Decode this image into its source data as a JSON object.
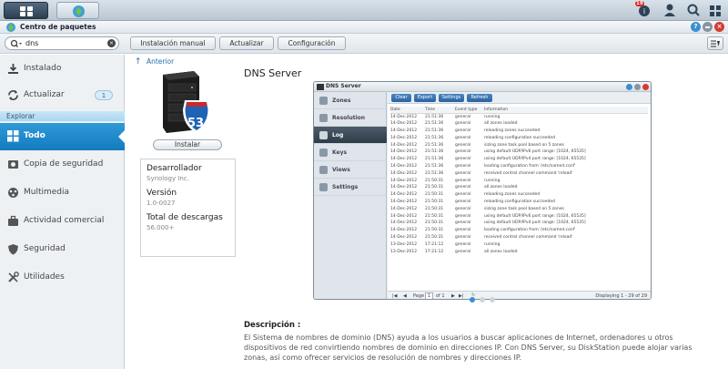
{
  "app": {
    "window_title": "Centro de paquetes",
    "notification_count": "19"
  },
  "search": {
    "value": "dns"
  },
  "toolbar": {
    "manual_install": "Instalación manual",
    "update": "Actualizar",
    "settings": "Configuración"
  },
  "sidebar": {
    "installed": "Instalado",
    "update": "Actualizar",
    "update_count": "1",
    "explore": "Explorar",
    "all": "Todo",
    "backup": "Copia de seguridad",
    "multimedia": "Multimedia",
    "business": "Actividad comercial",
    "security": "Seguridad",
    "utilities": "Utilidades"
  },
  "detail": {
    "back": "Anterior",
    "title": "DNS Server",
    "install": "Instalar",
    "icon_number": "53",
    "developer_label": "Desarrollador",
    "developer": "Synology Inc.",
    "version_label": "Versión",
    "version": "1.0-0027",
    "downloads_label": "Total de descargas",
    "downloads": "56.000+",
    "desc_label": "Descripción :",
    "description": "El Sistema de nombres de dominio (DNS) ayuda a los usuarios a buscar aplicaciones de Internet, ordenadores u otros dispositivos de red convirtiendo nombres de dominio en direcciones IP. Con DNS Server, su DiskStation puede alojar varias zonas, así como ofrecer servicios de resolución de nombres y direcciones IP."
  },
  "screenshot": {
    "title": "DNS Server",
    "menu": [
      "Zones",
      "Resolution",
      "Log",
      "Keys",
      "Views",
      "Settings"
    ],
    "buttons": [
      "Clear",
      "Export",
      "Settings",
      "Refresh"
    ],
    "columns": [
      "Date",
      "Time",
      "Event type",
      "Information"
    ],
    "rows": [
      [
        "14-Dec-2012",
        "21:51:36",
        "general",
        "running"
      ],
      [
        "14-Dec-2012",
        "21:51:36",
        "general",
        "all zones loaded"
      ],
      [
        "14-Dec-2012",
        "21:51:36",
        "general",
        "reloading zones succeeded"
      ],
      [
        "14-Dec-2012",
        "21:51:36",
        "general",
        "reloading configuration succeeded"
      ],
      [
        "14-Dec-2012",
        "21:51:36",
        "general",
        "sizing zone task pool based on 5 zones"
      ],
      [
        "14-Dec-2012",
        "21:51:36",
        "general",
        "using default UDP/IPv6 port range: [1024, 65535]"
      ],
      [
        "14-Dec-2012",
        "21:51:36",
        "general",
        "using default UDP/IPv4 port range: [1024, 65535]"
      ],
      [
        "14-Dec-2012",
        "21:51:36",
        "general",
        "loading configuration from '/etc/named.conf'"
      ],
      [
        "14-Dec-2012",
        "21:51:36",
        "general",
        "received control channel command 'reload'"
      ],
      [
        "14-Dec-2012",
        "21:50:31",
        "general",
        "running"
      ],
      [
        "14-Dec-2012",
        "21:50:31",
        "general",
        "all zones loaded"
      ],
      [
        "14-Dec-2012",
        "21:50:31",
        "general",
        "reloading zones succeeded"
      ],
      [
        "14-Dec-2012",
        "21:50:31",
        "general",
        "reloading configuration succeeded"
      ],
      [
        "14-Dec-2012",
        "21:50:31",
        "general",
        "sizing zone task pool based on 5 zones"
      ],
      [
        "14-Dec-2012",
        "21:50:31",
        "general",
        "using default UDP/IPv6 port range: [1024, 65535]"
      ],
      [
        "14-Dec-2012",
        "21:50:31",
        "general",
        "using default UDP/IPv4 port range: [1024, 65535]"
      ],
      [
        "14-Dec-2012",
        "21:50:31",
        "general",
        "loading configuration from '/etc/named.conf'"
      ],
      [
        "14-Dec-2012",
        "21:50:31",
        "general",
        "received control channel command 'reload'"
      ],
      [
        "13-Dec-2012",
        "17:21:12",
        "general",
        "running"
      ],
      [
        "13-Dec-2012",
        "17:21:12",
        "general",
        "all zones loaded"
      ]
    ],
    "page_label": "Page",
    "page_value": "1",
    "page_of": "of 1",
    "displaying": "Displaying 1 - 29 of 29"
  }
}
